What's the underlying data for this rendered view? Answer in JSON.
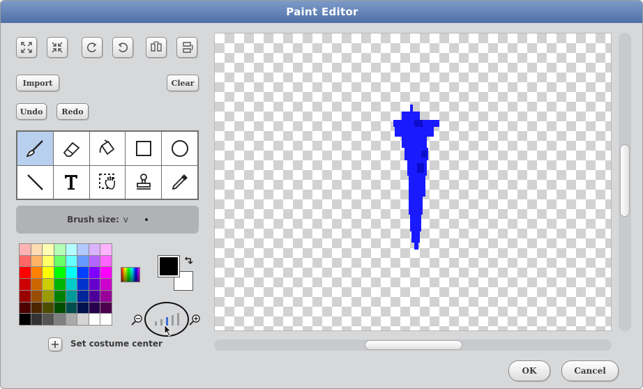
{
  "window": {
    "title": "Paint Editor"
  },
  "toolbar": {
    "icon_buttons": [
      "grow-icon",
      "shrink-icon",
      "rotate-left-icon",
      "rotate-right-icon",
      "flip-horizontal-icon",
      "flip-vertical-icon"
    ],
    "import_label": "Import",
    "clear_label": "Clear",
    "undo_label": "Undo",
    "redo_label": "Redo"
  },
  "tools": [
    {
      "icon": "paintbrush-icon",
      "active": true
    },
    {
      "icon": "eraser-icon",
      "active": false
    },
    {
      "icon": "paint-bucket-icon",
      "active": false
    },
    {
      "icon": "rectangle-icon",
      "active": false
    },
    {
      "icon": "ellipse-icon",
      "active": false
    },
    {
      "icon": "line-icon",
      "active": false
    },
    {
      "icon": "text-tool-icon",
      "active": false
    },
    {
      "icon": "select-icon",
      "active": false
    },
    {
      "icon": "stamp-icon",
      "active": false
    },
    {
      "icon": "eyedropper-icon",
      "active": false
    }
  ],
  "brush": {
    "label": "Brush size:",
    "chevron": "v"
  },
  "palette": {
    "colors": [
      [
        "#ffb3b3",
        "#ffdcb3",
        "#ffffb3",
        "#b3ffb3",
        "#b3ffff",
        "#b3c8ff",
        "#dcb3ff",
        "#ffb3ff"
      ],
      [
        "#ff6666",
        "#ffb366",
        "#ffff66",
        "#66ff66",
        "#66ffff",
        "#6699ff",
        "#b366ff",
        "#ff66ff"
      ],
      [
        "#ff0000",
        "#ff8000",
        "#ffff00",
        "#00ff00",
        "#00ffff",
        "#0040ff",
        "#8000ff",
        "#ff00ff"
      ],
      [
        "#cc0000",
        "#cc6600",
        "#cccc00",
        "#00b300",
        "#00cccc",
        "#0033cc",
        "#6600cc",
        "#cc00cc"
      ],
      [
        "#990000",
        "#994d00",
        "#999900",
        "#008000",
        "#009999",
        "#002699",
        "#4d0099",
        "#990099"
      ],
      [
        "#4d0000",
        "#4d2600",
        "#4d4d00",
        "#004d00",
        "#004d4d",
        "#00134d",
        "#26004d",
        "#4d004d"
      ],
      [
        "#000000",
        "#333333",
        "#555555",
        "#808080",
        "#aaaaaa",
        "#d4d4d4",
        "#ffffff",
        "#ffffff"
      ]
    ],
    "foreground_color": "#000000",
    "background_color": "#ffffff"
  },
  "center": {
    "label": "Set costume center"
  },
  "canvas": {
    "drawing_color": "#1a1aff"
  },
  "dialog": {
    "ok_label": "OK",
    "cancel_label": "Cancel"
  }
}
